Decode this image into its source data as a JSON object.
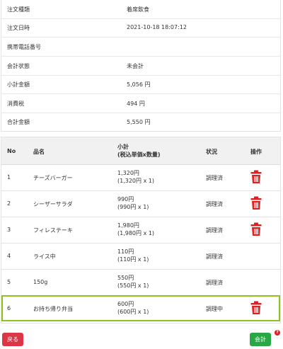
{
  "info": {
    "rows": [
      {
        "label": "注文種類",
        "value": "着席飲食"
      },
      {
        "label": "注文日時",
        "value": "2021-10-18 18:07:12"
      },
      {
        "label": "携帯電話番号",
        "value": ""
      },
      {
        "label": "会計状態",
        "value": "未会計"
      },
      {
        "label": "小計金額",
        "value": "5,056 円"
      },
      {
        "label": "消費税",
        "value": "494 円"
      },
      {
        "label": "合計金額",
        "value": "5,550 円"
      }
    ]
  },
  "orders": {
    "headers": {
      "no": "No",
      "name": "品名",
      "subtotal_line1": "小計",
      "subtotal_line2": "(税込単価x数量)",
      "status": "状況",
      "action": "操作"
    },
    "rows": [
      {
        "no": "1",
        "name": "チーズバーガー",
        "price": "1,320円",
        "detail": "(1,320円 x 1)",
        "status": "調理済",
        "delete_icon": "trash-icon"
      },
      {
        "no": "2",
        "name": "シーザーサラダ",
        "price": "990円",
        "detail": "(990円 x 1)",
        "status": "調理済",
        "delete_icon": "trash-icon"
      },
      {
        "no": "3",
        "name": "フィレステーキ",
        "price": "1,980円",
        "detail": "(1,980円 x 1)",
        "status": "調理済",
        "delete_icon": "trash-icon"
      },
      {
        "no": "4",
        "name": "ライス中",
        "price": "110円",
        "detail": "(110円 x 1)",
        "status": "調理済",
        "delete_icon": null
      },
      {
        "no": "5",
        "name": "150g",
        "price": "550円",
        "detail": "(550円 x 1)",
        "status": "調理済",
        "delete_icon": null
      },
      {
        "no": "6",
        "name": "お持ち帰り弁当",
        "price": "600円",
        "detail": "(600円 x 1)",
        "status": "調理中",
        "delete_icon": "trash-icon",
        "highlighted": true
      }
    ]
  },
  "footer": {
    "back_label": "戻る",
    "pay_label": "会計",
    "help_icon": "question-icon",
    "help_glyph": "?"
  },
  "colors": {
    "danger": "#dc3545",
    "success": "#28a745",
    "highlight": "#8dc21f",
    "trash": "#e02020"
  }
}
